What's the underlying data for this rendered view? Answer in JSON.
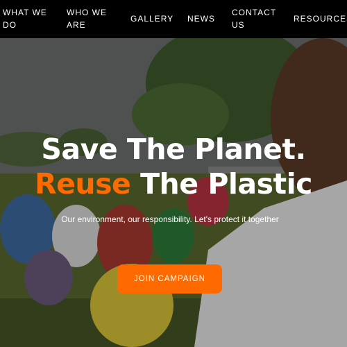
{
  "nav": {
    "items": [
      {
        "label": "WHAT WE DO"
      },
      {
        "label": "WHO WE ARE"
      },
      {
        "label": "GALLERY"
      },
      {
        "label": "NEWS"
      },
      {
        "label": "CONTACT US"
      },
      {
        "label": "RESOURCES"
      }
    ]
  },
  "hero": {
    "title_line1": "Save The Planet.",
    "title_accent": "Reuse",
    "title_line2_rest": " The Plastic",
    "tagline": "Our environment, our responsibility. Let's protect it together",
    "cta_label": "JOIN CAMPAIGN"
  },
  "colors": {
    "accent": "#ff6a00",
    "navbar": "#000000",
    "text": "#ffffff"
  }
}
